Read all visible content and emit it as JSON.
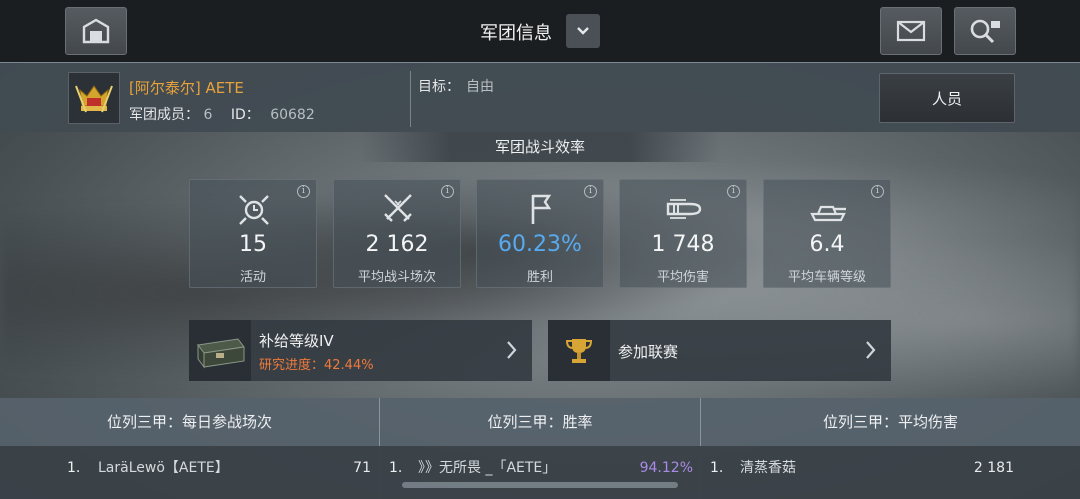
{
  "header": {
    "title": "军团信息",
    "home_icon": "hangar-icon",
    "mail_icon": "mail-icon",
    "search_icon": "search-clan-icon"
  },
  "clan": {
    "name": "[阿尔泰尔] AETE",
    "members_label": "军团成员：",
    "members_count": "6",
    "id_label": "ID：",
    "id_value": "60682",
    "goal_label": "目标：",
    "goal_value": "自由",
    "personnel_button": "人员"
  },
  "efficiency": {
    "heading": "军团战斗效率",
    "info_glyph": "i",
    "stats": [
      {
        "value": "15",
        "label": "活动",
        "icon": "activity-icon"
      },
      {
        "value": "2 162",
        "label": "平均战斗场次",
        "icon": "crossed-swords-icon"
      },
      {
        "value": "60.23%",
        "label": "胜利",
        "icon": "flag-icon"
      },
      {
        "value": "1 748",
        "label": "平均伤害",
        "icon": "shell-icon"
      },
      {
        "value": "6.4",
        "label": "平均车辆等级",
        "icon": "tank-icon"
      }
    ]
  },
  "supply": {
    "title": "补给等级IV",
    "progress": "研究进度：42.44%"
  },
  "league": {
    "title": "参加联赛"
  },
  "leaderboard": {
    "columns": [
      {
        "title": "位列三甲：每日参战场次",
        "rank": "1.",
        "player": "LaräLewö【AETE】",
        "value": "71"
      },
      {
        "title": "位列三甲：胜率",
        "rank": "1.",
        "player": "》》无所畏 _「AETE」",
        "value": "94.12%"
      },
      {
        "title": "位列三甲：平均伤害",
        "rank": "1.",
        "player": "清蒸香菇",
        "value": "2 181"
      }
    ]
  },
  "colors": {
    "clan_name": "#e8a23a",
    "win_rate": "#58aaf0",
    "research_progress": "#f07a3a",
    "top_winrate": "#a98be6"
  }
}
